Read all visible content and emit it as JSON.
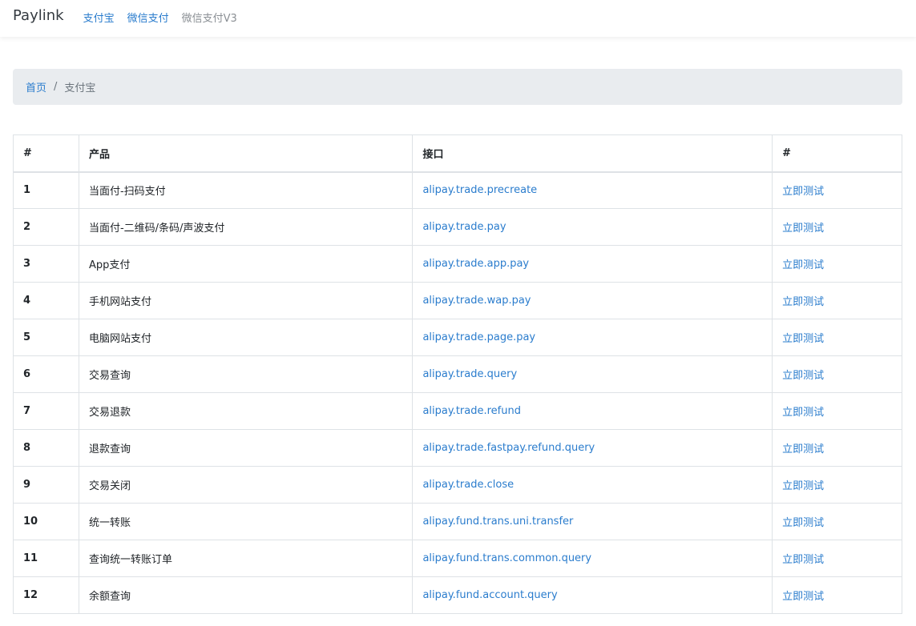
{
  "navbar": {
    "brand": "Paylink",
    "links": [
      {
        "label": "支付宝"
      },
      {
        "label": "微信支付"
      },
      {
        "label": "微信支付V3"
      }
    ]
  },
  "breadcrumb": {
    "home": "首页",
    "separator": "/",
    "current": "支付宝"
  },
  "table": {
    "headers": [
      "#",
      "产品",
      "接口",
      "#"
    ],
    "rows": [
      {
        "num": "1",
        "product": "当面付-扫码支付",
        "api": "alipay.trade.precreate",
        "action": "立即测试"
      },
      {
        "num": "2",
        "product": "当面付-二维码/条码/声波支付",
        "api": "alipay.trade.pay",
        "action": "立即测试"
      },
      {
        "num": "3",
        "product": "App支付",
        "api": "alipay.trade.app.pay",
        "action": "立即测试"
      },
      {
        "num": "4",
        "product": "手机网站支付",
        "api": "alipay.trade.wap.pay",
        "action": "立即测试"
      },
      {
        "num": "5",
        "product": "电脑网站支付",
        "api": "alipay.trade.page.pay",
        "action": "立即测试"
      },
      {
        "num": "6",
        "product": "交易查询",
        "api": "alipay.trade.query",
        "action": "立即测试"
      },
      {
        "num": "7",
        "product": "交易退款",
        "api": "alipay.trade.refund",
        "action": "立即测试"
      },
      {
        "num": "8",
        "product": "退款查询",
        "api": "alipay.trade.fastpay.refund.query",
        "action": "立即测试"
      },
      {
        "num": "9",
        "product": "交易关闭",
        "api": "alipay.trade.close",
        "action": "立即测试"
      },
      {
        "num": "10",
        "product": "统一转账",
        "api": "alipay.fund.trans.uni.transfer",
        "action": "立即测试"
      },
      {
        "num": "11",
        "product": "查询统一转账订单",
        "api": "alipay.fund.trans.common.query",
        "action": "立即测试"
      },
      {
        "num": "12",
        "product": "余额查询",
        "api": "alipay.fund.account.query",
        "action": "立即测试"
      }
    ]
  },
  "colors": {
    "link": "#2a7ccd",
    "muted_link": "#8a8f94",
    "breadcrumb_bg": "#e9ecef",
    "border": "#dee2e6"
  }
}
